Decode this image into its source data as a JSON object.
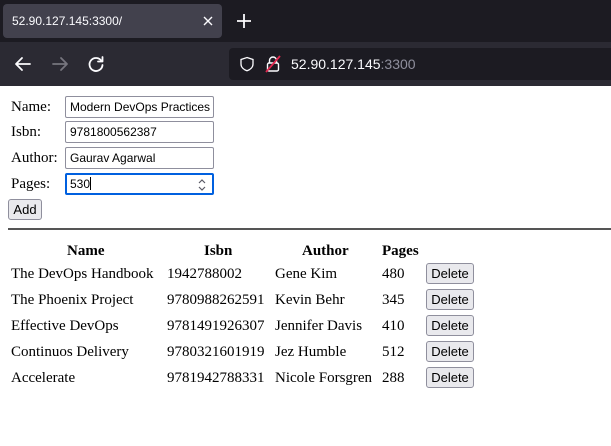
{
  "browser": {
    "tab_title": "52.90.127.145:3300/",
    "url_host": "52.90.127.145",
    "url_port": ":3300",
    "icons": [
      "close-icon",
      "plus-icon",
      "arrow-left-icon",
      "arrow-right-icon",
      "reload-icon",
      "shield-icon",
      "lock-icon"
    ]
  },
  "form": {
    "name_label": "Name:",
    "name_value": "Modern DevOps Practices",
    "isbn_label": "Isbn:",
    "isbn_value": "9781800562387",
    "author_label": "Author:",
    "author_value": "Gaurav Agarwal",
    "pages_label": "Pages:",
    "pages_value": "530",
    "add_label": "Add"
  },
  "table": {
    "headers": [
      "Name",
      "Isbn",
      "Author",
      "Pages"
    ],
    "delete_label": "Delete",
    "rows": [
      {
        "name": "The DevOps Handbook",
        "isbn": "1942788002",
        "author": "Gene Kim",
        "pages": "480"
      },
      {
        "name": "The Phoenix Project",
        "isbn": "9780988262591",
        "author": "Kevin Behr",
        "pages": "345"
      },
      {
        "name": "Effective DevOps",
        "isbn": "9781491926307",
        "author": "Jennifer Davis",
        "pages": "410"
      },
      {
        "name": "Continuos Delivery",
        "isbn": "9780321601919",
        "author": "Jez Humble",
        "pages": "512"
      },
      {
        "name": "Accelerate",
        "isbn": "9781942788331",
        "author": "Nicole Forsgren",
        "pages": "288"
      }
    ]
  }
}
